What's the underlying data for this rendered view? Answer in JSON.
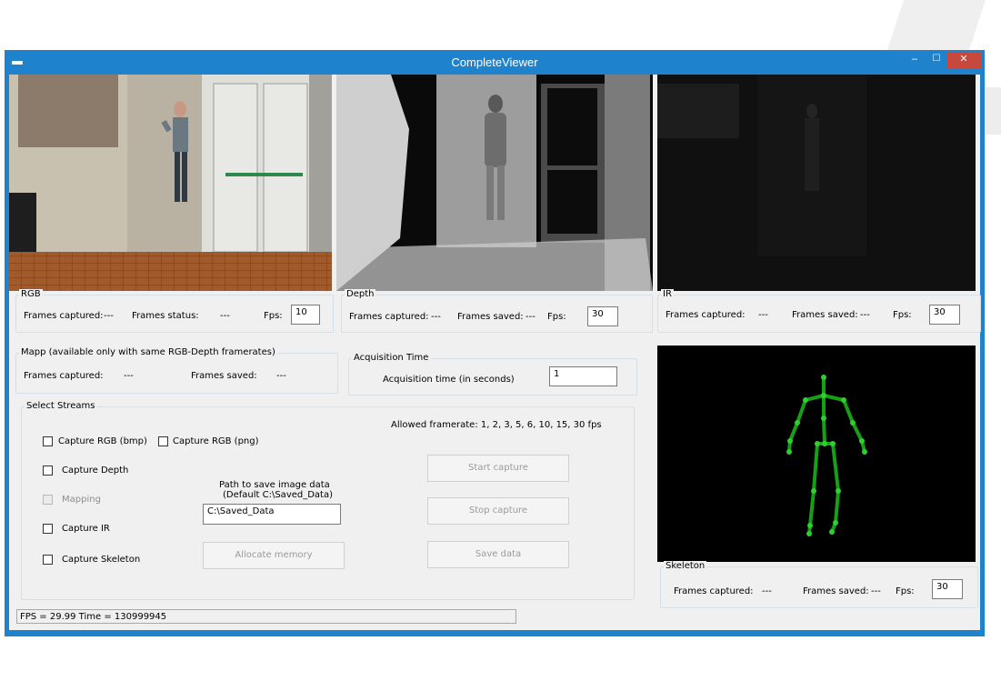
{
  "window": {
    "title": "CompleteViewer",
    "close_glyph": "✕",
    "min_glyph": "‒",
    "max_glyph": "☐"
  },
  "rgb": {
    "group_label": "RGB",
    "frames_captured_label": "Frames captured:",
    "frames_captured_value": "---",
    "frames_status_label": "Frames status:",
    "frames_status_value": "---",
    "fps_label": "Fps:",
    "fps_value": "10"
  },
  "depth": {
    "group_label": "Depth",
    "frames_captured_label": "Frames captured:",
    "frames_captured_value": "---",
    "frames_saved_label": "Frames saved:",
    "frames_saved_value": "---",
    "fps_label": "Fps:",
    "fps_value": "30"
  },
  "ir": {
    "group_label": "IR",
    "frames_captured_label": "Frames captured:",
    "frames_captured_value": "---",
    "frames_saved_label": "Frames saved:",
    "frames_saved_value": "---",
    "fps_label": "Fps:",
    "fps_value": "30"
  },
  "mapp": {
    "group_label": "Mapp   (available only with same RGB-Depth framerates)",
    "frames_captured_label": "Frames captured:",
    "frames_captured_value": "---",
    "frames_saved_label": "Frames saved:",
    "frames_saved_value": "---"
  },
  "acquisition": {
    "group_label": "Acquisition Time",
    "time_label": "Acquisition time (in seconds)",
    "time_value": "1"
  },
  "streams": {
    "group_label": "Select Streams",
    "allowed_framerate": "Allowed framerate: 1, 2, 3, 5, 6, 10, 15, 30 fps",
    "capture_rgb_bmp": "Capture RGB (bmp)",
    "capture_rgb_png": "Capture RGB (png)",
    "capture_depth": "Capture Depth",
    "mapping": "Mapping",
    "capture_ir": "Capture IR",
    "capture_skeleton": "Capture Skeleton",
    "path_label_1": "Path to save image data",
    "path_label_2": "(Default C:\\Saved_Data)",
    "path_value": "C:\\Saved_Data",
    "allocate_memory": "Allocate memory",
    "start_capture": "Start capture",
    "stop_capture": "Stop capture",
    "save_data": "Save data"
  },
  "skeleton": {
    "group_label": "Skeleton",
    "frames_captured_label": "Frames captured:",
    "frames_captured_value": "---",
    "frames_saved_label": "Frames saved:",
    "frames_saved_value": "---",
    "fps_label": "Fps:",
    "fps_value": "30",
    "joint_color": "#2fcf2f",
    "bone_color": "#16a016"
  },
  "status": {
    "text": "FPS = 29.99   Time = 130999945"
  },
  "colors": {
    "title_bar": "#1f82cc",
    "close_button": "#c7493d",
    "panel_bg": "#f0f0f0"
  }
}
